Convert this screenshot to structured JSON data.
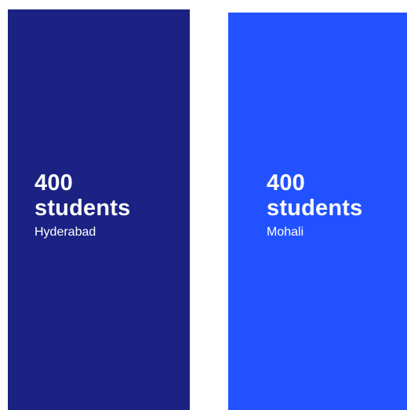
{
  "cards": [
    {
      "count": "400",
      "unit": "students",
      "location": "Hyderabad",
      "background": "#1b2283"
    },
    {
      "count": "400",
      "unit": "students",
      "location": "Mohali",
      "background": "#2252ff"
    }
  ],
  "text_color": "#ffffff"
}
